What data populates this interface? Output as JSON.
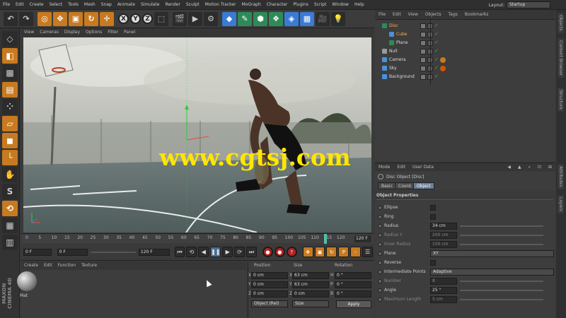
{
  "menubar": {
    "items": [
      "File",
      "Edit",
      "Create",
      "Select",
      "Tools",
      "Mesh",
      "Snap",
      "Animate",
      "Simulate",
      "Render",
      "Sculpt",
      "Motion Tracker",
      "MoGraph",
      "Character",
      "Plugins",
      "Script",
      "Window",
      "Help"
    ],
    "layout_label": "Layout:",
    "layout_value": "Startup"
  },
  "toolbar": {
    "axis_x": "X",
    "axis_y": "Y",
    "axis_z": "Z"
  },
  "viewport": {
    "menu": [
      "View",
      "Cameras",
      "Display",
      "Options",
      "Filter",
      "Panel"
    ],
    "watermark": "www.cgtsj.com"
  },
  "timeline": {
    "ticks": [
      "0",
      "5",
      "10",
      "15",
      "20",
      "25",
      "30",
      "35",
      "40",
      "45",
      "50",
      "55",
      "60",
      "65",
      "70",
      "75",
      "80",
      "85",
      "90",
      "95",
      "100",
      "105",
      "110",
      "115",
      "120"
    ],
    "frame": "120 F",
    "playhead_frame": 115,
    "max_frame": 120
  },
  "playback": {
    "start_field": "0 F",
    "current_field": "0 F",
    "end_field": "120 F"
  },
  "material_manager": {
    "menu": [
      "Create",
      "Edit",
      "Function",
      "Texture"
    ],
    "material_name": "Mat"
  },
  "coordinates": {
    "headers": [
      "Position",
      "Size",
      "Rotation"
    ],
    "rows": [
      {
        "axis": "X",
        "pos": "0 cm",
        "size_axis": "X",
        "size": "63 cm",
        "rot_axis": "H",
        "rot": "0 °"
      },
      {
        "axis": "Y",
        "pos": "0 cm",
        "size_axis": "Y",
        "size": "63 cm",
        "rot_axis": "P",
        "rot": "0 °"
      },
      {
        "axis": "Z",
        "pos": "0 cm",
        "size_axis": "Z",
        "size": "0 cm",
        "rot_axis": "B",
        "rot": "0 °"
      }
    ],
    "mode": "Object (Rel)",
    "size_mode": "Size",
    "apply": "Apply"
  },
  "object_manager": {
    "menu": [
      "File",
      "Edit",
      "View",
      "Objects",
      "Tags",
      "Bookmarks"
    ],
    "objects": [
      {
        "name": "Disc",
        "level": 0,
        "selected": true,
        "color": "#2e8b57"
      },
      {
        "name": "Cube",
        "level": 1,
        "selected": true,
        "color": "#4a90d9"
      },
      {
        "name": "Plane",
        "level": 1,
        "selected": false,
        "color": "#2e8b57"
      },
      {
        "name": "Null",
        "level": 0,
        "selected": false,
        "color": "#999999"
      },
      {
        "name": "Camera",
        "level": 0,
        "selected": false,
        "color": "#4a90d9"
      },
      {
        "name": "Sky",
        "level": 0,
        "selected": false,
        "color": "#4a90d9"
      },
      {
        "name": "Background",
        "level": 0,
        "selected": false,
        "color": "#4a90d9"
      }
    ]
  },
  "side_tabs": {
    "top": [
      "Objects",
      "Content Browser",
      "Structure"
    ],
    "bottom": [
      "Attributes",
      "Layers"
    ]
  },
  "attributes": {
    "menu": [
      "Mode",
      "Edit",
      "User Data"
    ],
    "title": "Disc Object [Disc]",
    "tabs": [
      "Basic",
      "Coord.",
      "Object"
    ],
    "active_tab": "Object",
    "section": "Object Properties",
    "rows": [
      {
        "label": "Ellipse",
        "type": "check",
        "dim": false
      },
      {
        "label": "Ring",
        "type": "check",
        "dim": false
      },
      {
        "label": "Radius",
        "type": "field",
        "value": "34 cm",
        "dim": false
      },
      {
        "label": "Radius Y",
        "type": "field",
        "value": "200 cm",
        "dim": true
      },
      {
        "label": "Inner Radius",
        "type": "field",
        "value": "100 cm",
        "dim": true
      },
      {
        "label": "Plane",
        "type": "drop",
        "value": "XY",
        "dim": false
      },
      {
        "label": "Reverse",
        "type": "check",
        "dim": false
      },
      {
        "label": "Intermediate Points",
        "type": "drop",
        "value": "Adaptive",
        "dim": false
      },
      {
        "label": "Number",
        "type": "field",
        "value": "8",
        "dim": true
      },
      {
        "label": "Angle",
        "type": "field",
        "value": "25 °",
        "dim": false
      },
      {
        "label": "Maximum Length",
        "type": "field",
        "value": "5 cm",
        "dim": true
      }
    ]
  },
  "logo": "MAXON CINEMA 4D",
  "colors": {
    "accent_orange": "#c87a20",
    "selection_orange": "#ffb040",
    "watermark_yellow": "#ffe600",
    "record_red": "#b52222"
  }
}
